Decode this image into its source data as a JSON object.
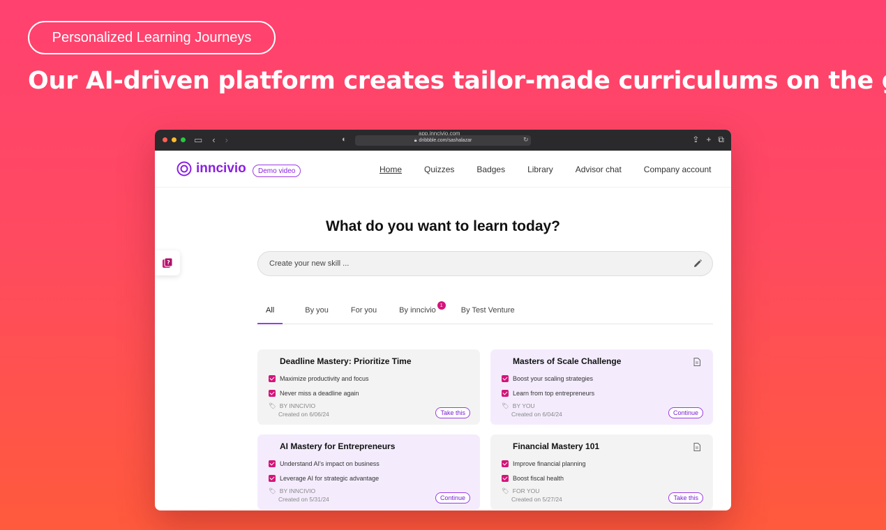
{
  "hero": {
    "pill": "Personalized Learning Journeys",
    "headline": "Our AI-driven platform creates tailor-made curriculums on the go"
  },
  "browser": {
    "tab_hint": "app.inncivio.com",
    "url": "dribbble.com/sashalazar",
    "dot_colors": [
      "#ff5f57",
      "#febc2e",
      "#28c840"
    ]
  },
  "nav": {
    "logo": "inncivio",
    "demo": "Demo video",
    "menu": [
      "Home",
      "Quizzes",
      "Badges",
      "Library",
      "Advisor chat",
      "Company account"
    ],
    "active": "Home"
  },
  "main": {
    "title": "What do you want to learn today?",
    "search_placeholder": "Create your new skill ...",
    "tabs": [
      "All",
      "By you",
      "For you",
      "By inncivio",
      "By Test Venture"
    ],
    "tab_badge": "1"
  },
  "cards": [
    {
      "title": "Deadline Mastery: Prioritize Time",
      "points": [
        "Maximize productivity and focus",
        "Never miss a deadline again"
      ],
      "source": "BY INNCIVIO",
      "created": "Created on 6/06/24",
      "action": "Take this"
    },
    {
      "title": "Masters of Scale Challenge",
      "points": [
        "Boost your scaling strategies",
        "Learn from top entrepreneurs"
      ],
      "source": "BY YOU",
      "created": "Created on 6/04/24",
      "action": "Continue"
    },
    {
      "title": "AI Mastery for Entrepreneurs",
      "points": [
        "Understand AI's impact on business",
        "Leverage AI for strategic advantage"
      ],
      "source": "BY INNCIVIO",
      "created": "Created on 5/31/24",
      "action": "Continue"
    },
    {
      "title": "Financial Mastery 101",
      "points": [
        "Improve financial planning",
        "Boost fiscal health"
      ],
      "source": "FOR YOU",
      "created": "Created on 5/27/24",
      "action": "Take this"
    }
  ],
  "colors": {
    "accent": "#8a1fe0",
    "checkbox": "#d4157a"
  }
}
